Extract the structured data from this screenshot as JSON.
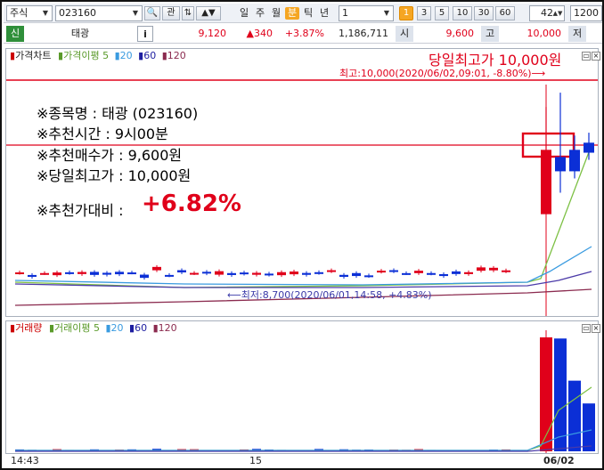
{
  "toolbar": {
    "market": "주식",
    "code": "023160",
    "search_glyph": "🔍",
    "kwan": "관",
    "periods": [
      "일",
      "주",
      "월",
      "분",
      "틱",
      "년"
    ],
    "selected_period": "분",
    "interval_value": "1",
    "minute_buttons": [
      "1",
      "3",
      "5",
      "10",
      "30",
      "60"
    ],
    "count_value": "42",
    "max_value": "1200"
  },
  "quote": {
    "tag": "신",
    "name": "태광",
    "info_button": "i",
    "price": "9,120",
    "change": "▲340",
    "change_pct": "+3.87%",
    "volume": "1,186,711",
    "open_label": "시",
    "open": "9,600",
    "high_label": "고",
    "high": "10,000",
    "low_label": "저"
  },
  "price_panel": {
    "legend_main": "가격차트",
    "legend_ma_label": "가격이평",
    "legend_ma": [
      "5",
      "20",
      "60",
      "120"
    ],
    "headline": "당일최고가 10,000원",
    "high_note": "최고:10,000(2020/06/02,09:01, -8.80%)⟶",
    "low_note": "⟵최저:8,700(2020/06/01,14:58, +4.83%)"
  },
  "info_block": {
    "name_line": "※종목명 : 태광 (023160)",
    "time_line": "※추천시간 : 9시00분",
    "buy_line": "※추천매수가 : 9,600원",
    "high_line": "※당일최고가 : 10,000원",
    "ratio_label": "※추천가대비 :",
    "ratio_value": "+6.82%"
  },
  "volume_panel": {
    "legend_main": "거래량",
    "legend_ma_label": "거래이평",
    "legend_ma": [
      "5",
      "20",
      "60",
      "120"
    ]
  },
  "xaxis": {
    "labels": [
      "14:43",
      "15",
      "06/02"
    ]
  },
  "chart_data": {
    "type": "candlestick",
    "price_ylim": [
      8500,
      10150
    ],
    "highlight_level": 10000,
    "candles_day2": [
      {
        "open": 9600,
        "high": 9900,
        "low": 9450,
        "close": 9150
      },
      {
        "open": 9450,
        "high": 10000,
        "low": 9300,
        "close": 9550
      },
      {
        "open": 9450,
        "high": 9700,
        "low": 9400,
        "close": 9600
      },
      {
        "open": 9580,
        "high": 9720,
        "low": 9530,
        "close": 9650
      }
    ],
    "volume_day2": [
      100,
      99,
      62,
      42
    ]
  },
  "colors": {
    "up": "#e0001a",
    "down": "#0b2fd6",
    "ma5": "#7cc043",
    "ma20": "#3a9be0",
    "ma60": "#4b3aa8",
    "ma120": "#8b2b4f",
    "highlight": "#e0001a"
  }
}
